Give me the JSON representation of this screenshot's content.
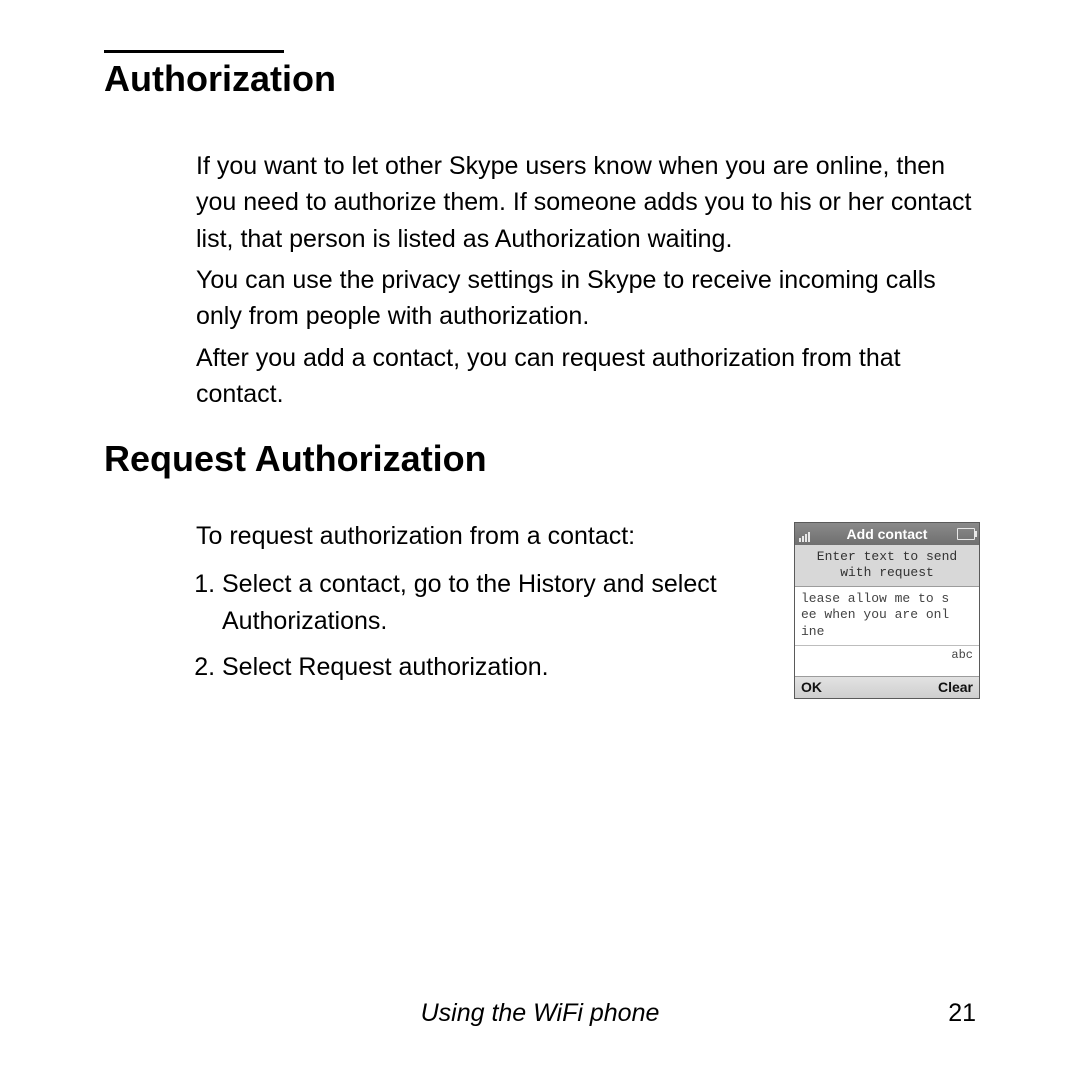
{
  "heading1": "Authorization",
  "para1": "If you want to let other Skype users know when you are online, then you need to authorize them. If someone adds you to his or her contact list, that person is listed as Authorization waiting.",
  "para2": "You can use the privacy settings in Skype to receive incoming calls only from people with authorization.",
  "para3": "After you add a contact, you can request authorization from that contact.",
  "heading2": "Request Authorization",
  "intro2": "To request authorization from a contact:",
  "steps": [
    "Select a contact, go to the History and select Authorizations.",
    "Select Request authorization."
  ],
  "phone": {
    "title": "Add contact",
    "prompt_line1": "Enter text to send",
    "prompt_line2": "with request",
    "message": "lease allow me to s\nee when you are onl\nine",
    "input_mode": "abc",
    "softkey_left": "OK",
    "softkey_right": "Clear"
  },
  "footer": "Using the WiFi phone",
  "page_number": "21"
}
